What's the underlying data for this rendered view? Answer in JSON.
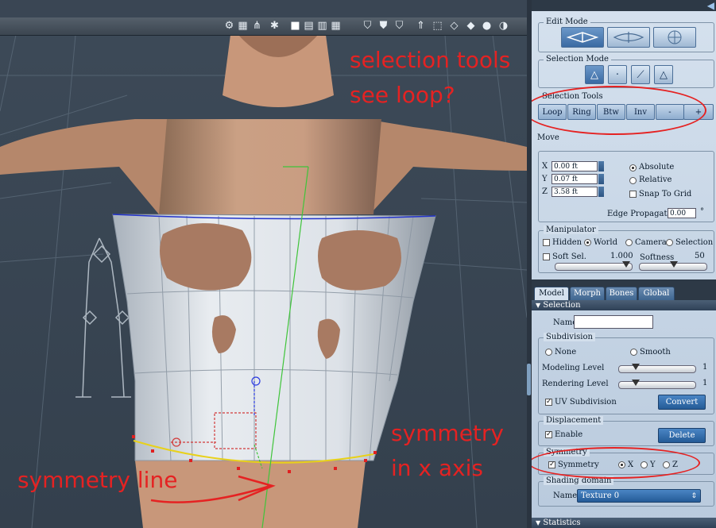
{
  "annotations": {
    "selection_tools_line1": "selection tools",
    "selection_tools_line2": "see loop?",
    "symmetry_axis_line1": "symmetry",
    "symmetry_axis_line2": "in x axis",
    "symmetry_line": "symmetry line"
  },
  "toolbar_icons": [
    "hierarchy-icon",
    "grid-icon",
    "joints-icon",
    "network-icon",
    "single-view-icon",
    "two-view-icon",
    "three-view-icon",
    "four-view-icon",
    "shield-icon",
    "shield-check-icon",
    "shield-outline-icon",
    "arrow-up-icon",
    "dashed-cube-icon",
    "wire-cube-icon",
    "shaded-cube-icon",
    "sphere-icon",
    "sphere-half-icon"
  ],
  "edit_mode": {
    "title": "Edit Mode"
  },
  "selection_mode": {
    "title": "Selection Mode"
  },
  "selection_tools": {
    "title": "Selection Tools",
    "buttons": [
      "Loop",
      "Ring",
      "Btw",
      "Inv",
      "-",
      "+"
    ]
  },
  "move": {
    "title": "Move",
    "x_label": "X",
    "x_value": "0.00 ft",
    "y_label": "Y",
    "y_value": "0.07 ft",
    "z_label": "Z",
    "z_value": "3.58 ft",
    "absolute": "Absolute",
    "relative": "Relative",
    "snap_to_grid": "Snap To Grid",
    "edge_propagation_label": "Edge Propagation",
    "edge_propagation_value": "0.00",
    "degree": "°"
  },
  "manipulator": {
    "title": "Manipulator",
    "hidden": "Hidden",
    "world": "World",
    "camera": "Camera",
    "selection": "Selection",
    "soft_sel": "Soft Sel.",
    "soft_sel_value": "1.000",
    "softness": "Softness",
    "softness_value": "50"
  },
  "tabs": [
    "Model",
    "Morph",
    "Bones",
    "Global"
  ],
  "selection_section": {
    "header": "Selection",
    "name_label": "Name",
    "name_value": ""
  },
  "subdivision": {
    "title": "Subdivision",
    "none": "None",
    "smooth": "Smooth",
    "modeling_level_label": "Modeling Level",
    "modeling_level_value": "1",
    "rendering_level_label": "Rendering Level",
    "rendering_level_value": "1",
    "uv_subdivision": "UV Subdivision",
    "convert": "Convert"
  },
  "displacement": {
    "title": "Displacement",
    "enable": "Enable",
    "delete": "Delete"
  },
  "symmetry": {
    "title": "Symmetry",
    "checkbox_label": "Symmetry",
    "x": "X",
    "y": "Y",
    "z": "Z"
  },
  "shading_domain": {
    "title": "Shading domain",
    "name_label": "Name",
    "value": "Texture 0"
  },
  "statistics": {
    "header": "Statistics"
  }
}
